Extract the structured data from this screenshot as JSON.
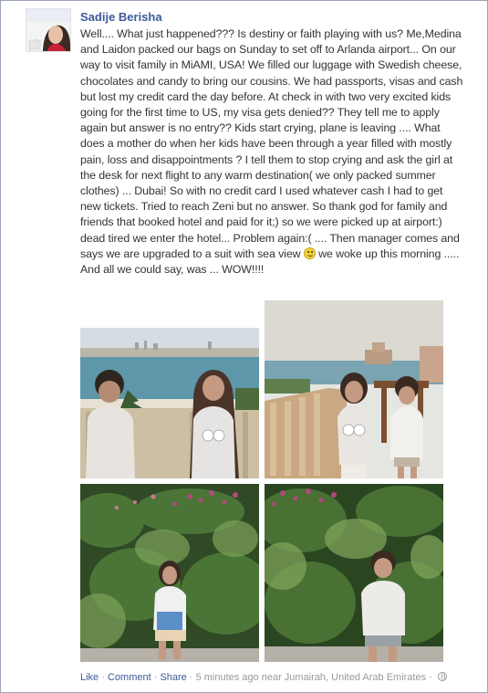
{
  "post": {
    "author": "Sadije Berisha",
    "text": "Well.... What just happened??? Is destiny or faith playing with us? Me,Medina and Laidon packed our bags on Sunday to set off to Arlanda airport... On our way to visit family in MiAMI, USA! We filled our luggage with Swedish cheese, chocolates and candy to bring our cousins. We had passports, visas and cash but lost my credit card the day before. At check in with two very excited kids going for the first time to US, my visa gets denied?? They tell me to apply again but answer is no entry?? Kids start crying, plane is leaving .... What does a mother do when her kids have been through a year filled with mostly pain, loss and disappointments ? I tell them to stop crying and ask the girl at the desk for next flight to any warm destination( we only packed summer clothes) ... Dubai! So with no credit card I used whatever cash I had to get new tickets. Tried to reach Zeni but no answer. So thank god for family and friends that booked hotel and paid for it;) so we were picked up at airport:) dead tired we enter the hotel... Problem again:( .... Then manager comes and says we are upgraded to a suit with sea view",
    "text_tail": "we woke up this morning ..... And all we could say, was ... WOW!!!!",
    "smiley_icon": "smiley-emoticon"
  },
  "actions": {
    "like": "Like",
    "comment": "Comment",
    "share": "Share",
    "sep": " · ",
    "meta": "5 minutes ago near Jumairah, United Arab Emirates",
    "privacy_icon": "globe-icon"
  },
  "colors": {
    "link": "#3b5998",
    "meta": "#999999"
  }
}
